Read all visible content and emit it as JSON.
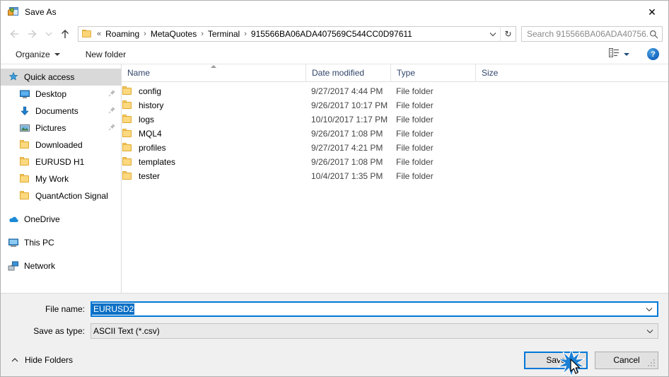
{
  "window": {
    "title": "Save As",
    "title_icon": "save-as-icon",
    "close_label": "✕"
  },
  "address": {
    "back_icon": "back-arrow-icon",
    "forward_icon": "forward-arrow-icon",
    "recent_icon": "recent-locations-icon",
    "up_icon": "up-arrow-icon",
    "folder_icon": "folder-icon",
    "overflow": "«",
    "separator": "›",
    "crumbs": [
      "Roaming",
      "MetaQuotes",
      "Terminal",
      "915566BA06ADA407569C544CC0D97611"
    ],
    "dropdown_icon": "chevron-down-icon",
    "refresh_icon": "refresh-icon",
    "refresh_glyph": "↻"
  },
  "search": {
    "placeholder": "Search 915566BA06ADA40756...",
    "icon": "search-icon"
  },
  "toolbar": {
    "organize_label": "Organize",
    "organize_caret": "chevron-down-icon",
    "new_folder_label": "New folder",
    "view_icon": "view-layout-icon",
    "view_caret": "chevron-down-icon",
    "help_icon": "help-icon",
    "help_glyph": "?"
  },
  "sidebar": {
    "items": [
      {
        "label": "Quick access",
        "icon": "star-pin-icon",
        "level": 0,
        "selected": true,
        "pinned": false
      },
      {
        "label": "Desktop",
        "icon": "desktop-icon",
        "level": 1,
        "selected": false,
        "pinned": true
      },
      {
        "label": "Documents",
        "icon": "documents-icon",
        "level": 1,
        "selected": false,
        "pinned": true
      },
      {
        "label": "Pictures",
        "icon": "pictures-icon",
        "level": 1,
        "selected": false,
        "pinned": true
      },
      {
        "label": "Downloaded",
        "icon": "folder-icon",
        "level": 1,
        "selected": false,
        "pinned": false
      },
      {
        "label": "EURUSD H1",
        "icon": "folder-icon",
        "level": 1,
        "selected": false,
        "pinned": false
      },
      {
        "label": "My Work",
        "icon": "folder-icon",
        "level": 1,
        "selected": false,
        "pinned": false
      },
      {
        "label": "QuantAction Signal",
        "icon": "folder-icon",
        "level": 1,
        "selected": false,
        "pinned": false
      },
      {
        "label": "OneDrive",
        "icon": "onedrive-icon",
        "level": 0,
        "selected": false,
        "pinned": false
      },
      {
        "label": "This PC",
        "icon": "this-pc-icon",
        "level": 0,
        "selected": false,
        "pinned": false
      },
      {
        "label": "Network",
        "icon": "network-icon",
        "level": 0,
        "selected": false,
        "pinned": false
      }
    ]
  },
  "filelist": {
    "columns": [
      {
        "label": "Name",
        "sorted": "asc"
      },
      {
        "label": "Date modified",
        "sorted": ""
      },
      {
        "label": "Type",
        "sorted": ""
      },
      {
        "label": "Size",
        "sorted": ""
      }
    ],
    "rows": [
      {
        "name": "config",
        "modified": "9/27/2017 4:44 PM",
        "type": "File folder",
        "size": ""
      },
      {
        "name": "history",
        "modified": "9/26/2017 10:17 PM",
        "type": "File folder",
        "size": ""
      },
      {
        "name": "logs",
        "modified": "10/10/2017 1:17 PM",
        "type": "File folder",
        "size": ""
      },
      {
        "name": "MQL4",
        "modified": "9/26/2017 1:08 PM",
        "type": "File folder",
        "size": ""
      },
      {
        "name": "profiles",
        "modified": "9/27/2017 4:21 PM",
        "type": "File folder",
        "size": ""
      },
      {
        "name": "templates",
        "modified": "9/26/2017 1:08 PM",
        "type": "File folder",
        "size": ""
      },
      {
        "name": "tester",
        "modified": "10/4/2017 1:35 PM",
        "type": "File folder",
        "size": ""
      }
    ]
  },
  "form": {
    "filename_label": "File name:",
    "filename_value": "EURUSD2",
    "filename_selected": true,
    "savetype_label": "Save as type:",
    "savetype_value": "ASCII Text (*.csv)"
  },
  "footer": {
    "hide_folders_label": "Hide Folders",
    "hide_folders_icon": "chevron-up-icon",
    "save_label": "Save",
    "cancel_label": "Cancel",
    "resize_grip_icon": "resize-grip-icon"
  },
  "overlay": {
    "click_burst_icon": "click-burst-icon",
    "cursor_icon": "mouse-cursor-icon",
    "accent_color": "#0078d7",
    "burst_color": "#1b7fd4"
  }
}
